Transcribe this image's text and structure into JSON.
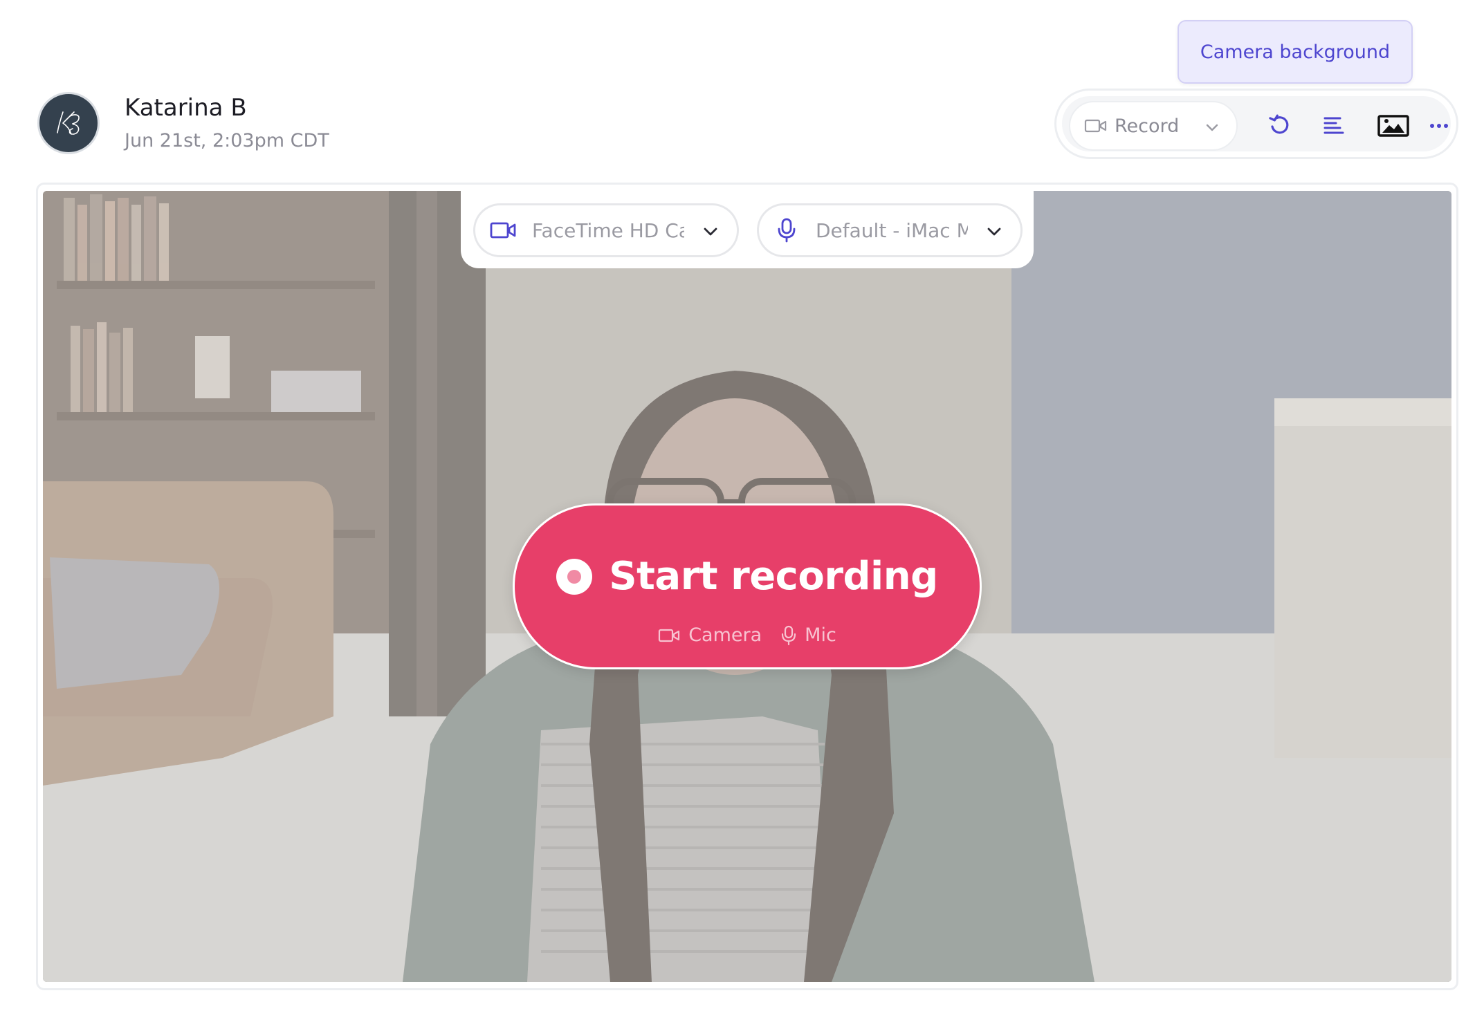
{
  "user": {
    "name": "Katarina B",
    "timestamp": "Jun 21st, 2:03pm CDT",
    "avatar_initials": "KB"
  },
  "tooltip": {
    "text": "Camera background"
  },
  "toolbar": {
    "record_label": "Record",
    "icons": [
      "camera-icon",
      "chevron-down-icon",
      "undo-icon",
      "text-align-icon",
      "image-icon",
      "more-icon"
    ]
  },
  "devices": {
    "camera": "FaceTime HD Camera",
    "mic": "Default - iMac Microphone"
  },
  "start": {
    "label": "Start recording",
    "camera_label": "Camera",
    "mic_label": "Mic"
  },
  "colors": {
    "accent": "#4d45cf",
    "record_red": "#e73f69",
    "tooltip_bg": "#ecebfd"
  }
}
